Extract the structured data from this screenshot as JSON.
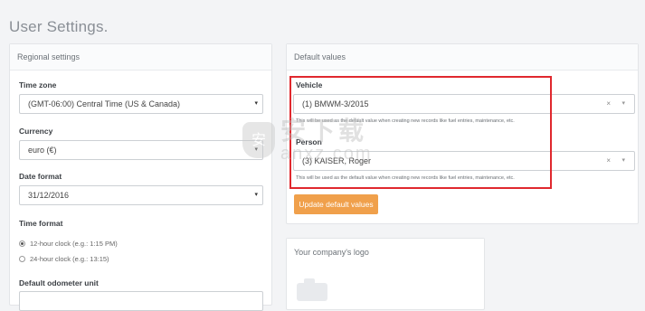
{
  "page": {
    "title": "User Settings."
  },
  "regional": {
    "header": "Regional settings",
    "timezone": {
      "label": "Time zone",
      "value": "(GMT-06:00) Central Time (US & Canada)"
    },
    "currency": {
      "label": "Currency",
      "value": "euro (€)"
    },
    "date_format": {
      "label": "Date format",
      "value": "31/12/2016"
    },
    "time_format": {
      "label": "Time format",
      "options": [
        {
          "label": "12-hour clock (e.g.: 1:15 PM)",
          "checked": true
        },
        {
          "label": "24-hour clock (e.g.: 13:15)",
          "checked": false
        }
      ]
    },
    "odometer": {
      "label": "Default odometer unit"
    }
  },
  "defaults": {
    "header": "Default values",
    "vehicle": {
      "label": "Vehicle",
      "value": "(1) BMWM-3/2015",
      "hint": "This will be used as the default value when creating new records like fuel entries, maintenance, etc."
    },
    "person": {
      "label": "Person",
      "value": "(3) KAISER, Roger",
      "hint": "This will be used as the default value when creating new records like fuel entries, maintenance, etc."
    },
    "update_button": "Update default values"
  },
  "logo": {
    "header": "Your company's logo"
  },
  "icons": {
    "caret": "▾",
    "clear": "×"
  },
  "watermark": {
    "cn": "安下载",
    "en": "anxz.com"
  }
}
